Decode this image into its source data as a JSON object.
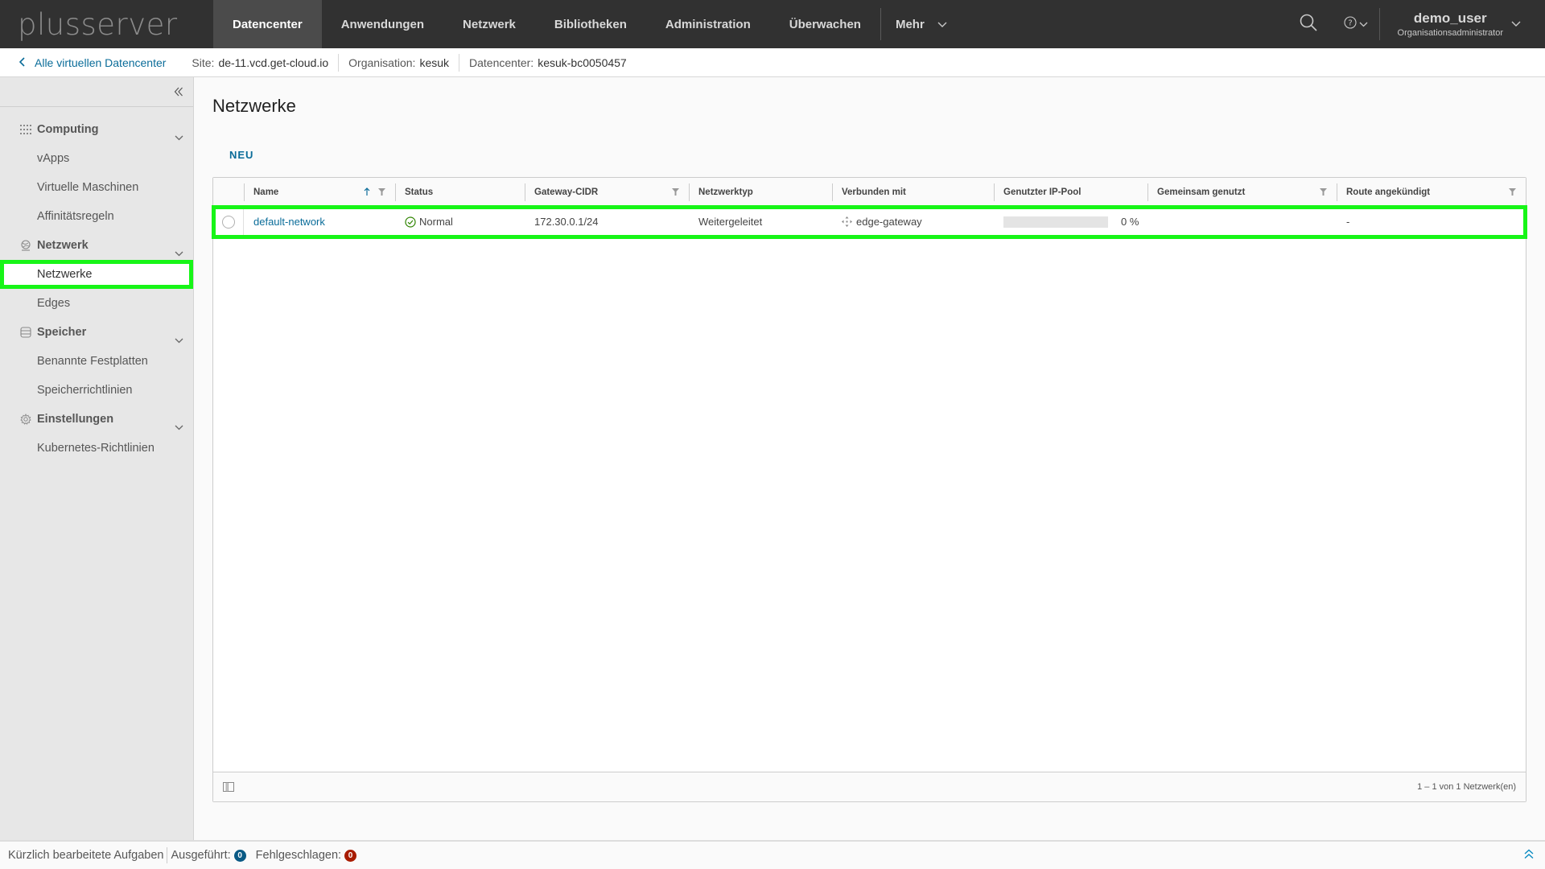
{
  "header": {
    "logo": "plusserver",
    "nav": [
      {
        "label": "Datencenter",
        "active": true
      },
      {
        "label": "Anwendungen"
      },
      {
        "label": "Netzwerk"
      },
      {
        "label": "Bibliotheken"
      },
      {
        "label": "Administration"
      },
      {
        "label": "Überwachen"
      }
    ],
    "more_label": "Mehr",
    "user": {
      "name": "demo_user",
      "role": "Organisationsadministrator"
    }
  },
  "breadcrumb": {
    "back_label": "Alle virtuellen Datencenter",
    "site_label": "Site:",
    "site_value": "de-11.vcd.get-cloud.io",
    "org_label": "Organisation:",
    "org_value": "kesuk",
    "dc_label": "Datencenter:",
    "dc_value": "kesuk-bc0050457"
  },
  "sidebar": {
    "groups": [
      {
        "label": "Computing",
        "icon": "grid-icon",
        "items": [
          "vApps",
          "Virtuelle Maschinen",
          "Affinitätsregeln"
        ]
      },
      {
        "label": "Netzwerk",
        "icon": "network-globe-icon",
        "items": [
          "Netzwerke",
          "Edges"
        ]
      },
      {
        "label": "Speicher",
        "icon": "database-icon",
        "items": [
          "Benannte Festplatten",
          "Speicherrichtlinien"
        ]
      },
      {
        "label": "Einstellungen",
        "icon": "gear-icon",
        "items": [
          "Kubernetes-Richtlinien"
        ]
      }
    ],
    "active_item": "Netzwerke"
  },
  "main": {
    "title": "Netzwerke",
    "new_button": "NEU",
    "table": {
      "columns": [
        "Name",
        "Status",
        "Gateway-CIDR",
        "Netzwerktyp",
        "Verbunden mit",
        "Genutzter IP-Pool",
        "Gemeinsam genutzt",
        "Route angekündigt"
      ],
      "rows": [
        {
          "name": "default-network",
          "status": "Normal",
          "gateway_cidr": "172.30.0.1/24",
          "network_type": "Weitergeleitet",
          "connected_to": "edge-gateway",
          "ip_pool_used_percent": 0,
          "ip_pool_label": "0 %",
          "shared": "",
          "route_advertised": "-"
        }
      ],
      "footer": "1 – 1 von 1 Netzwerk(en)"
    }
  },
  "taskbar": {
    "recent_label": "Kürzlich bearbeitete Aufgaben",
    "executed_label": "Ausgeführt:",
    "executed_count": "0",
    "failed_label": "Fehlgeschlagen:",
    "failed_count": "0"
  },
  "colors": {
    "accent": "#0a6c99",
    "header_bg": "#313131",
    "highlight": "#17f517",
    "status_ok": "#2f8400",
    "failed": "#a81c00"
  }
}
